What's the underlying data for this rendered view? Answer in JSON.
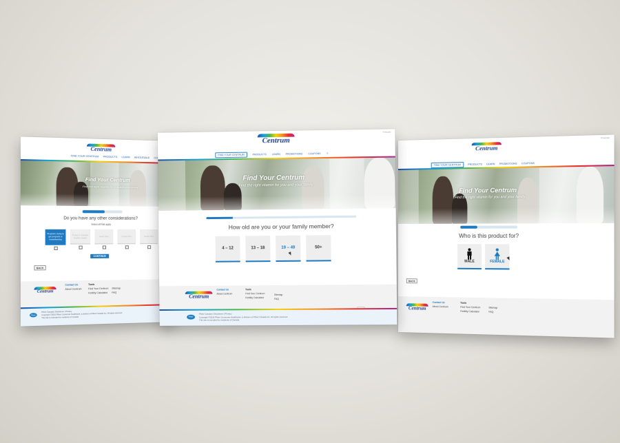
{
  "screens": {
    "left": {
      "nav": [
        "Find Your Centrum",
        "Products",
        "Learn",
        "Wholesale",
        "Coupons"
      ],
      "hero_title": "Find Your Centrum",
      "hero_sub": "Find the right vitamin for you and your family",
      "question": "Do you have any other considerations?",
      "select_note": "Select all that apply",
      "options": [
        "Pregnant, trying to get pregnant or breastfeeding",
        "Trying to maintain healthy weight",
        "Heart Plus",
        "Cardio Plus",
        "Health Plus"
      ],
      "continue_label": "CONTINUE",
      "back_label": "BACK",
      "footer": {
        "contact": "Contact Us",
        "about": "About Centrum",
        "tools_hd": "Tools",
        "tools": [
          "Find Your Centrum",
          "Fertility Calculator"
        ],
        "links": [
          "Sitemap",
          "FAQ"
        ]
      },
      "subfooter": [
        "Pfizer Canada  |  Disclaimer  |  Privacy",
        "Copyright ©2016 Pfizer Consumer Healthcare, a division of Pfizer Canada Inc. All rights reserved.",
        "This site is intended for residents of Canada"
      ]
    },
    "center": {
      "util": "Français",
      "nav": [
        "Find Your Centrum",
        "Products",
        "Learn",
        "Promotions",
        "Coupons"
      ],
      "hero_title": "Find Your Centrum",
      "hero_sub": "Find the right vitamin for you and your family",
      "question": "How old are you or your family member?",
      "options": [
        "4 – 12",
        "13 – 18",
        "19 – 49",
        "50+"
      ],
      "footer": {
        "contact": "Contact Us",
        "about": "About Centrum",
        "tools_hd": "Tools",
        "tools": [
          "Find Your Centrum",
          "Fertility Calculator"
        ],
        "links": [
          "Sitemap",
          "FAQ"
        ]
      },
      "top_label": "TOP",
      "subfooter": [
        "Pfizer Canada  |  Disclaimer  |  Privacy",
        "Copyright ©2016 Pfizer Consumer Healthcare, a division of Pfizer Canada Inc. All rights reserved.",
        "This site is intended for residents of Canada"
      ]
    },
    "right": {
      "util": "Français",
      "nav": [
        "Find Your Centrum",
        "Products",
        "Learn",
        "Promotions",
        "Coupons"
      ],
      "hero_title": "Find Your Centrum",
      "hero_sub": "Find the right vitamin for you and your family",
      "question": "Who is this product for?",
      "options": [
        "MALE",
        "FEMALE"
      ],
      "back_label": "BACK",
      "footer": {
        "contact": "Contact Us",
        "about": "About Centrum",
        "tools_hd": "Tools",
        "tools": [
          "Find Your Centrum",
          "Fertility Calculator"
        ],
        "links": [
          "Sitemap",
          "FAQ"
        ]
      }
    }
  },
  "brand": {
    "logo_word": "Centrum",
    "pfizer": "Pfizer",
    "accent": "#1e7bc2",
    "navy": "#1c3f94"
  },
  "progress": {
    "left": 0.55,
    "center": 0.18,
    "right": 0.3
  }
}
